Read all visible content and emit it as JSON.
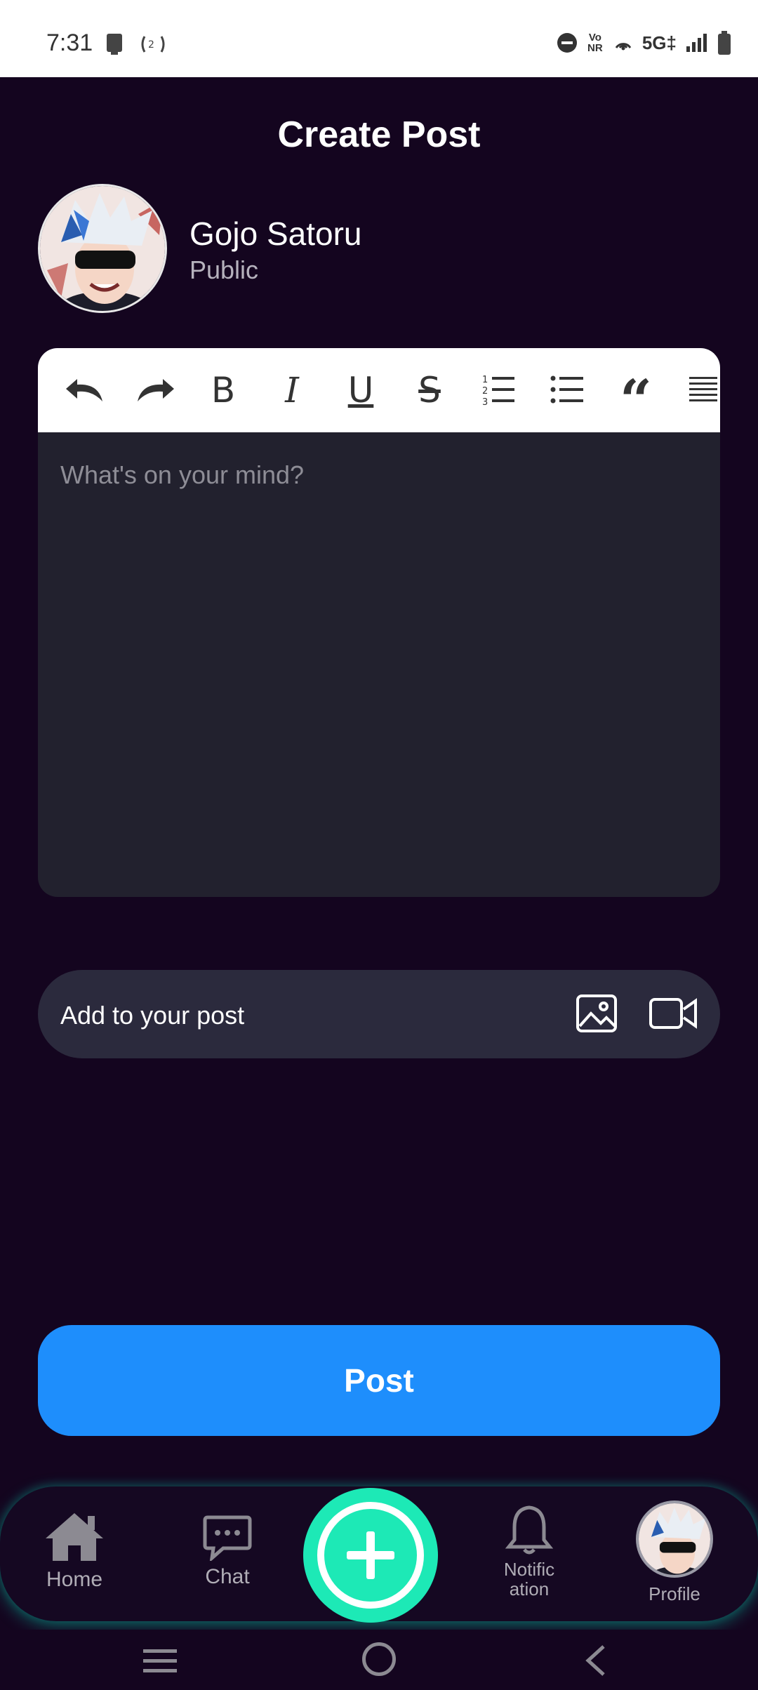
{
  "status_bar": {
    "time": "7:31",
    "network": "5G‡",
    "vonr": "Vo NR",
    "icons": [
      "screen-cast-icon",
      "hotspot-icon",
      "dnd-icon",
      "vonr-icon",
      "wifi-calling-icon",
      "signal-icon",
      "battery-icon"
    ]
  },
  "header": {
    "title": "Create Post"
  },
  "user": {
    "name": "Gojo Satoru",
    "visibility": "Public"
  },
  "editor": {
    "toolbar": [
      "undo-icon",
      "redo-icon",
      "bold-icon",
      "italic-icon",
      "underline-icon",
      "strikethrough-icon",
      "ordered-list-icon",
      "bullet-list-icon",
      "quote-icon",
      "align-justify-icon"
    ],
    "bold_glyph": "B",
    "italic_glyph": "I",
    "underline_glyph": "U",
    "strike_glyph": "S",
    "quote_glyph": "“",
    "placeholder": "What's on your mind?"
  },
  "add_to_post": {
    "label": "Add to your post",
    "icons": [
      "image-icon",
      "video-icon"
    ]
  },
  "post_button": {
    "label": "Post"
  },
  "bottom_nav": {
    "home": "Home",
    "chat": "Chat",
    "notification_line1": "Notific",
    "notification_line2": "ation",
    "profile": "Profile"
  },
  "colors": {
    "background": "#14051f",
    "accent": "#1e8efc",
    "fab": "#1de9b6",
    "editor": "#22212e",
    "addbar": "#2b2a3d"
  }
}
